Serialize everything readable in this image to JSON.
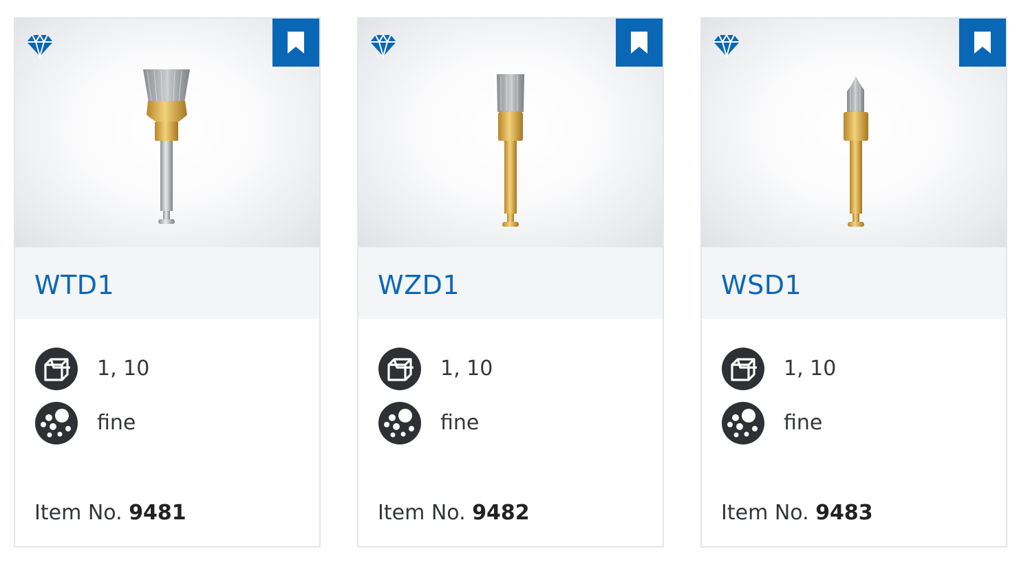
{
  "products": [
    {
      "name": "WTD1",
      "packaging": "1, 10",
      "grain": "fine",
      "item_label": "Item No.",
      "item_number": "9481",
      "shank": "silver"
    },
    {
      "name": "WZD1",
      "packaging": "1, 10",
      "grain": "fine",
      "item_label": "Item No.",
      "item_number": "9482",
      "shank": "gold"
    },
    {
      "name": "WSD1",
      "packaging": "1, 10",
      "grain": "fine",
      "item_label": "Item No.",
      "item_number": "9483",
      "shank": "gold"
    }
  ],
  "icons": {
    "badge": "diamond-icon",
    "save": "bookmark-icon",
    "packaging": "package-box-icon",
    "grain": "grain-size-icon"
  },
  "colors": {
    "accent": "#0a67b6",
    "title_bg": "#f3f5f7",
    "text": "#333538",
    "icon_dark": "#2e3033",
    "gold": "#d9a43a",
    "silver": "#b8bcc0"
  }
}
